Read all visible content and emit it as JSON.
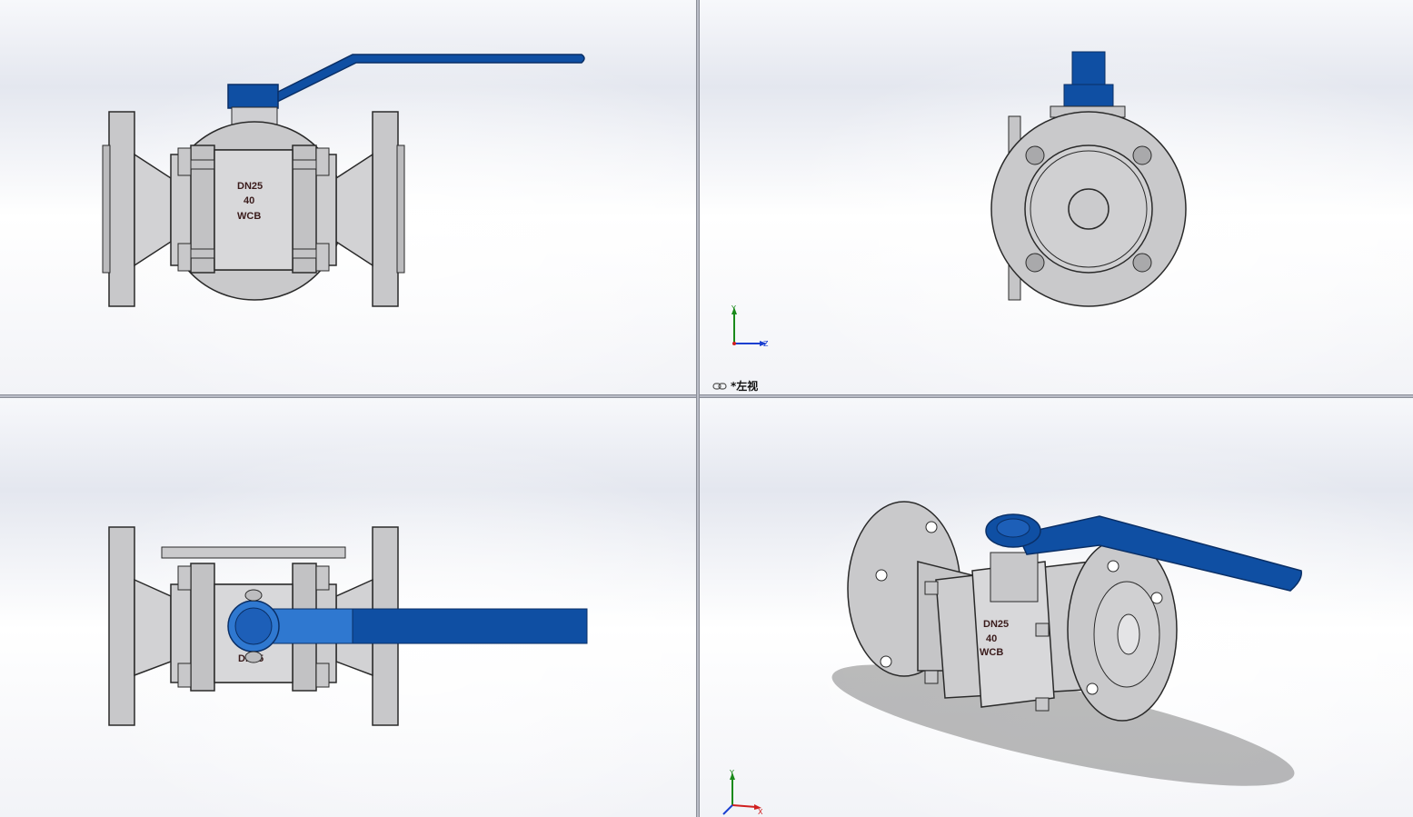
{
  "viewports": {
    "front": {
      "marking": {
        "line1": "DN25",
        "line2": "40",
        "line3": "WCB"
      }
    },
    "left": {
      "view_label": "*左视",
      "triad": {
        "y": "Y",
        "z": "Z"
      }
    },
    "top": {
      "marking_partial": "DN25"
    },
    "iso": {
      "marking": {
        "line1": "DN25",
        "line2": "40",
        "line3": "WCB"
      },
      "triad": {
        "y": "Y",
        "x": "X"
      }
    }
  },
  "colors": {
    "handle_blue": "#0f4fa3",
    "handle_light": "#2f78d0",
    "metal": "#c7c7c9",
    "outline": "#2a2a2a",
    "split": "#b9bcc6"
  },
  "icons": {
    "view_link": "link-icon"
  }
}
